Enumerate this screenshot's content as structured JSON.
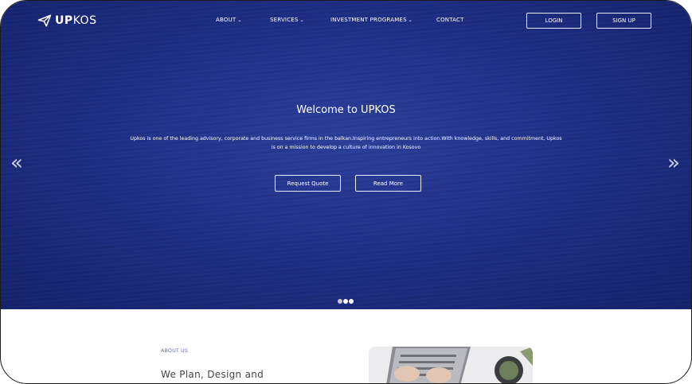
{
  "brand": {
    "name_bold": "UP",
    "name_light": "KOS"
  },
  "nav": {
    "items": [
      {
        "label": "ABOUT",
        "has_dropdown": true
      },
      {
        "label": "SERVICES",
        "has_dropdown": true
      },
      {
        "label": "INVESTMENT PROGRAMES",
        "has_dropdown": true
      },
      {
        "label": "CONTACT",
        "has_dropdown": false
      }
    ],
    "login_label": "LOGIN",
    "signup_label": "SIGN UP"
  },
  "hero": {
    "title": "Welcome to UPKOS",
    "description_line1": "Upkos is one of the leading advisory, corporate and business service firms in the balkan.Inspiring entrepreneurs into action.With knowledge, skills, and commitment, Upkos",
    "description_line2": "is on a mission to develop a culture of innovation in Kosovo",
    "primary_button": "Request Quote",
    "secondary_button": "Read More",
    "prev_arrow": "«",
    "next_arrow": "»",
    "slides_total": 3,
    "active_slide": 2
  },
  "about": {
    "label": "ABOUT US",
    "heading": "We Plan, Design and"
  },
  "icons": {
    "logo": "paper-plane-icon",
    "dropdown": "chevron-down-icon"
  },
  "colors": {
    "hero_blue": "#1f2f86",
    "accent_purple": "#6a6ccf"
  }
}
